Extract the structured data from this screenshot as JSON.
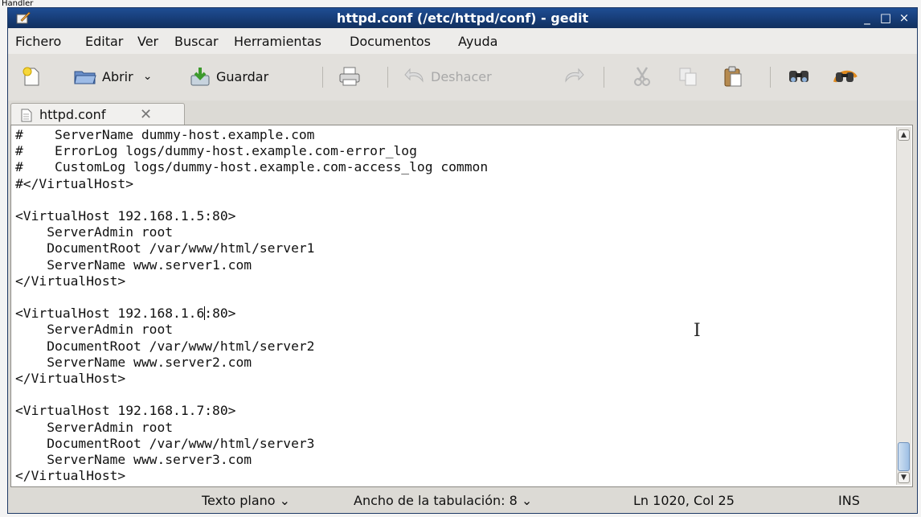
{
  "page_label": "Handler",
  "window": {
    "title": "httpd.conf (/etc/httpd/conf) - gedit",
    "controls": {
      "minimize": "_",
      "maximize": "□",
      "close": "×"
    }
  },
  "menu": [
    "Fichero",
    "Editar",
    "Ver",
    "Buscar",
    "Herramientas",
    "Documentos",
    "Ayuda"
  ],
  "toolbar": {
    "new_icon": "new-document-icon",
    "open_label": "Abrir",
    "open_dropdown": "⌄",
    "save_label": "Guardar",
    "print_icon": "print-icon",
    "undo_label": "Deshacer",
    "redo_icon": "redo-icon",
    "cut_icon": "cut-icon",
    "copy_icon": "copy-icon",
    "paste_icon": "paste-icon",
    "find_icon": "find-icon",
    "replace_icon": "find-replace-icon"
  },
  "tab": {
    "label": "httpd.conf",
    "close": "✕"
  },
  "editor": {
    "lines": [
      "#    ServerName dummy-host.example.com",
      "#    ErrorLog logs/dummy-host.example.com-error_log",
      "#    CustomLog logs/dummy-host.example.com-access_log common",
      "#</VirtualHost>",
      "",
      "<VirtualHost 192.168.1.5:80>",
      "    ServerAdmin root",
      "    DocumentRoot /var/www/html/server1",
      "    ServerName www.server1.com",
      "</VirtualHost>",
      "",
      "<VirtualHost 192.168.1.6:80>",
      "    ServerAdmin root",
      "    DocumentRoot /var/www/html/server2",
      "    ServerName www.server2.com",
      "</VirtualHost>",
      "",
      "<VirtualHost 192.168.1.7:80>",
      "    ServerAdmin root",
      "    DocumentRoot /var/www/html/server3",
      "    ServerName www.server3.com",
      "</VirtualHost>"
    ],
    "cursor": {
      "line": 11,
      "column": 24
    },
    "mouse_cursor": "I"
  },
  "statusbar": {
    "syntax": "Texto plano ⌄",
    "tab_width": "Ancho de la tabulación:  8 ⌄",
    "position": "Ln 1020, Col 25",
    "mode": "INS"
  },
  "colors": {
    "titlebar": "#163b74",
    "scroll_thumb": "#9fc0e4"
  }
}
